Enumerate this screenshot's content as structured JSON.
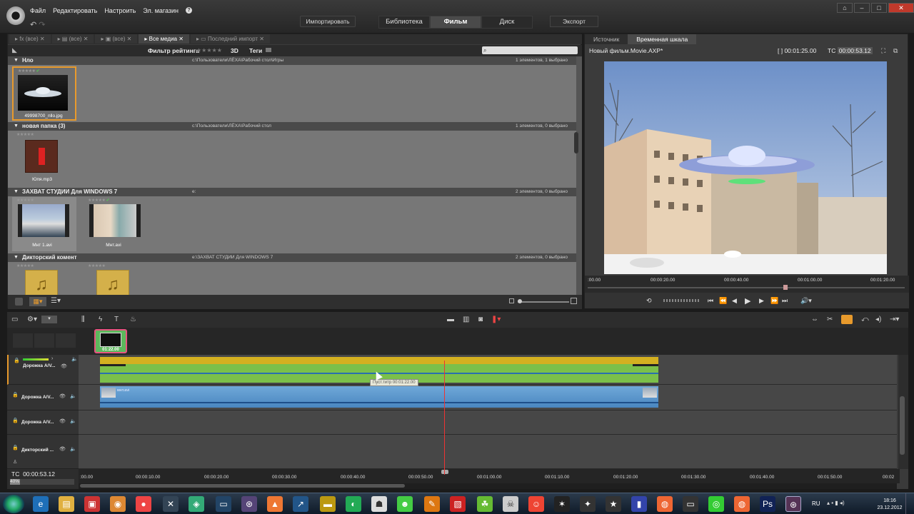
{
  "menu": {
    "items": [
      "Файл",
      "Редактировать",
      "Настроить",
      "Эл. магазин"
    ],
    "help_icon": "help-icon"
  },
  "toolbar": {
    "import_label": "Импортировать",
    "tabs": [
      "Библиотека",
      "Фильм",
      "Диск"
    ],
    "active_tab": "Фильм",
    "export_label": "Экспорт",
    "window_controls": [
      "cart-icon",
      "minimize-icon",
      "maximize-icon",
      "close-icon"
    ]
  },
  "library": {
    "tabs": [
      "(все)",
      "(все)",
      "(все)",
      "Все медиа",
      "Последний импорт"
    ],
    "active_tab": "Все медиа",
    "rating_filter_label": "Фильтр рейтинга",
    "filter_3d_label": "3D",
    "tags_label": "Теги",
    "groups": [
      {
        "name": "Нло",
        "path": "c:\\Пользователи\\ЛЁХА\\Рабочий стол\\Игры",
        "count": "1 элементов, 1 выбрано",
        "items": [
          {
            "name": "49998700_nllo.jpg",
            "kind": "image"
          }
        ]
      },
      {
        "name": "новая папка (3)",
        "path": "c:\\Пользователи\\ЛЁХА\\Рабочий стол",
        "count": "1 элементов, 0 выбрано",
        "items": [
          {
            "name": "Юпя.mp3",
            "kind": "audio"
          }
        ]
      },
      {
        "name": "ЗАХВАТ СТУДИИ Для WINDOWS 7",
        "path": "e:",
        "count": "2 элементов, 0 выбрано",
        "items": [
          {
            "name": "Мнт 1.avi",
            "kind": "video"
          },
          {
            "name": "Мнт.avi",
            "kind": "video"
          }
        ]
      },
      {
        "name": "Дикторский комент",
        "path": "e:\\ЗАХВАТ СТУДИИ Для WINDOWS 7",
        "count": "2 элементов, 0 выбрано",
        "items": [
          {
            "name": "",
            "kind": "music"
          },
          {
            "name": "",
            "kind": "music"
          }
        ]
      }
    ]
  },
  "preview": {
    "tabs": [
      "Источник",
      "Временная шкала"
    ],
    "active_tab": "Временная шкала",
    "title": "Новый фильм.Movie.AXP*",
    "duration": "[ ] 00:01:25.00",
    "tc_label": "TC",
    "tc_value": "00:00:53.12",
    "ruler": [
      ":00.00",
      "00:00:20.00",
      "00:00:40.00",
      "00:01:00.00",
      "00:01:20.00"
    ]
  },
  "timeline": {
    "clip_thumb_label": "01:22.00",
    "tracks": [
      {
        "name": "Дорожка А/V..."
      },
      {
        "name": "Дорожка А/V..."
      },
      {
        "name": "Дорожка А/V..."
      },
      {
        "name": "Дикторский ..."
      }
    ],
    "video_clip_label": "мнт.avi",
    "tooltip": "Пуст.титр  00:01:22.00",
    "tc_label": "TC",
    "tc_value": "00:00:53.12",
    "zoom": "40%",
    "ruler": [
      ":00.00",
      "00:00:10.00",
      "00:00:20.00",
      "00:00:30.00",
      "00:00:40.00",
      "00:00:50.00",
      "00:01:00.00",
      "00:01:10.00",
      "00:01:20.00",
      "00:01:30.00",
      "00:01:40.00",
      "00:01:50.00",
      "00:02"
    ]
  },
  "taskbar": {
    "lang": "RU",
    "time": "18:16",
    "date": "23.12.2012"
  }
}
